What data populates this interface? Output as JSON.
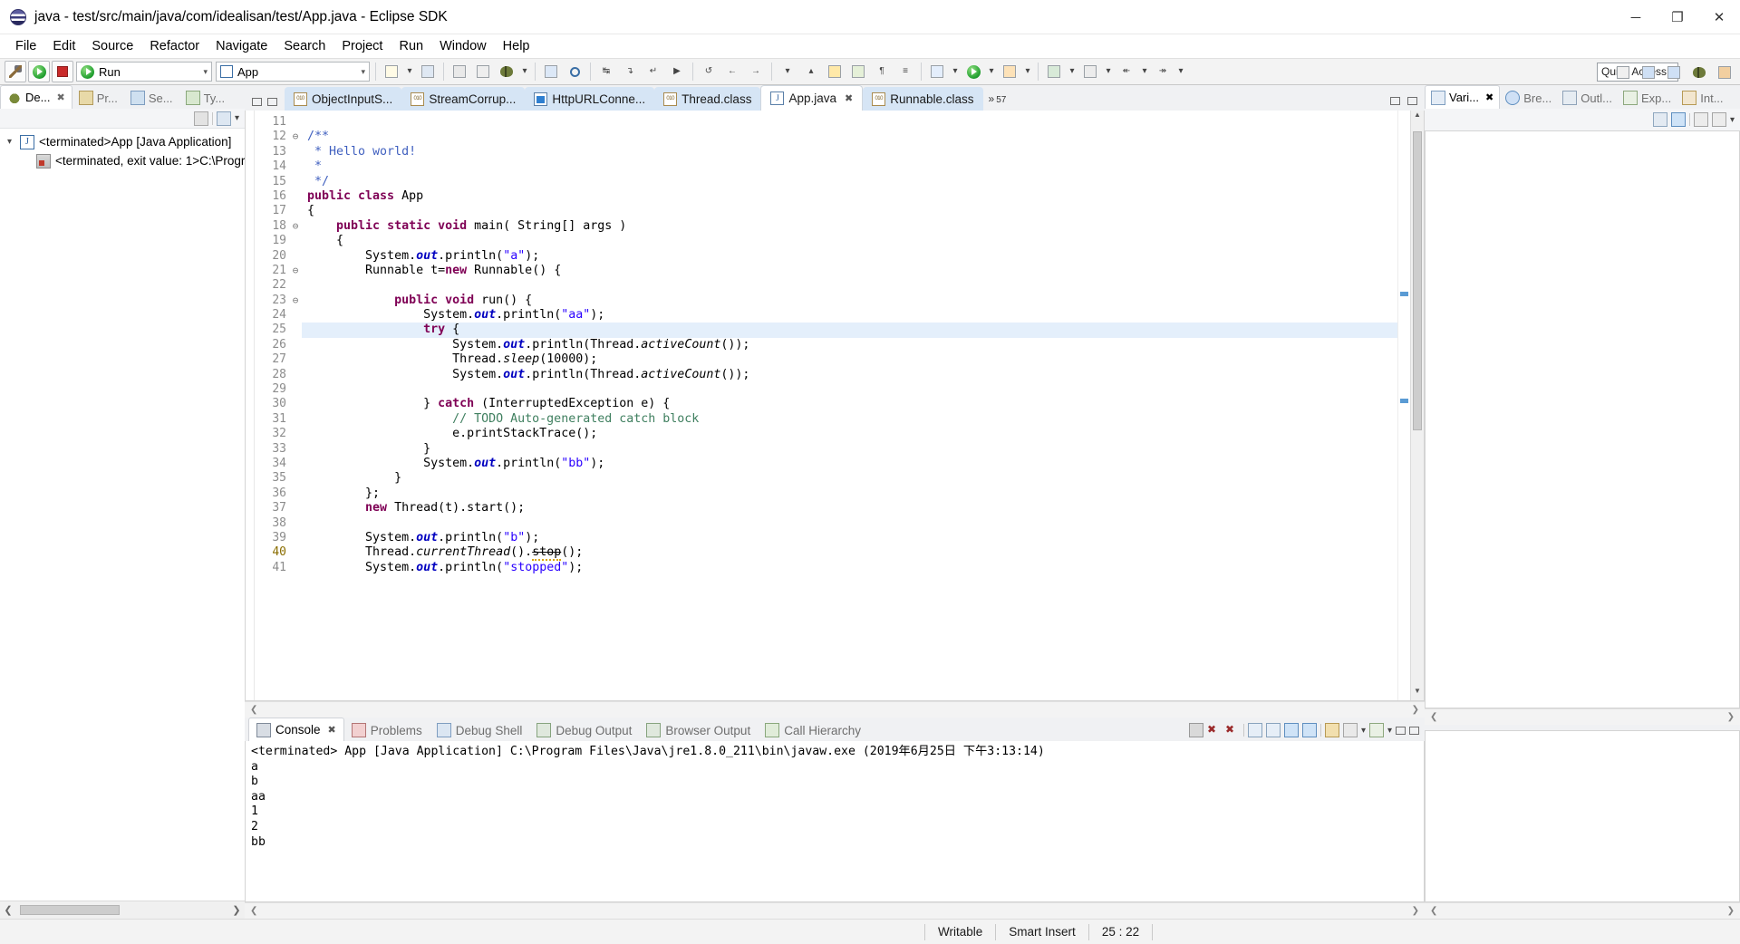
{
  "window": {
    "title": "java - test/src/main/java/com/idealisan/test/App.java - Eclipse SDK",
    "app_icon": "eclipse-icon",
    "controls": {
      "minimize": "─",
      "maximize": "❐",
      "close": "✕"
    }
  },
  "menubar": {
    "items": [
      "File",
      "Edit",
      "Source",
      "Refactor",
      "Navigate",
      "Search",
      "Project",
      "Run",
      "Window",
      "Help"
    ]
  },
  "toolbar": {
    "build_label": "hammer-icon",
    "run_combo": {
      "value": "Run",
      "icon": "run-green-icon"
    },
    "launch_combo": {
      "value": "App",
      "icon": "java-app-icon"
    },
    "quick_access": {
      "value": "Quick Access",
      "placeholder": "Quick Access"
    }
  },
  "left_panel": {
    "tabs": [
      {
        "label": "De...",
        "icon": "debug-icon",
        "active": true,
        "closable": true
      },
      {
        "label": "Pr...",
        "icon": "package-explorer-icon",
        "active": false
      },
      {
        "label": "Se...",
        "icon": "servers-icon",
        "active": false
      },
      {
        "label": "Ty...",
        "icon": "type-hierarchy-icon",
        "active": false
      }
    ],
    "tree": [
      {
        "label": "<terminated>App [Java Application]",
        "icon": "java-launch-icon",
        "indent": 0,
        "expanded": true
      },
      {
        "label": "<terminated, exit value: 1>C:\\Progr…",
        "icon": "process-icon",
        "indent": 1,
        "expanded": false
      }
    ]
  },
  "editor": {
    "tabs": [
      {
        "label": "ObjectInputS...",
        "icon": "class-file-icon",
        "active": false
      },
      {
        "label": "StreamCorrup...",
        "icon": "class-file-icon",
        "active": false
      },
      {
        "label": "HttpURLConne...",
        "icon": "html-file-icon",
        "active": false
      },
      {
        "label": "Thread.class",
        "icon": "class-file-icon",
        "active": false
      },
      {
        "label": "App.java",
        "icon": "java-file-icon",
        "active": true,
        "closable": true
      },
      {
        "label": "Runnable.class",
        "icon": "class-file-icon",
        "active": false
      }
    ],
    "overflow_label": "»",
    "overflow_count": "57",
    "first_line_number": 11,
    "highlight_line": 25,
    "lines": [
      {
        "n": 11,
        "text": ""
      },
      {
        "n": 12,
        "fold": "minus",
        "tokens": [
          {
            "t": "/**",
            "c": "jdoc"
          }
        ]
      },
      {
        "n": 13,
        "tokens": [
          {
            "t": " * Hello world!",
            "c": "jdoc"
          }
        ]
      },
      {
        "n": 14,
        "tokens": [
          {
            "t": " *",
            "c": "jdoc"
          }
        ]
      },
      {
        "n": 15,
        "tokens": [
          {
            "t": " */",
            "c": "jdoc"
          }
        ]
      },
      {
        "n": 16,
        "tokens": [
          {
            "t": "public class",
            "c": "kw"
          },
          {
            "t": " App",
            "c": ""
          }
        ]
      },
      {
        "n": 17,
        "tokens": [
          {
            "t": "{",
            "c": ""
          }
        ]
      },
      {
        "n": 18,
        "fold": "minus",
        "tokens": [
          {
            "t": "    ",
            "c": ""
          },
          {
            "t": "public static void",
            "c": "kw"
          },
          {
            "t": " main( String[] args )",
            "c": ""
          }
        ]
      },
      {
        "n": 19,
        "tokens": [
          {
            "t": "    {",
            "c": ""
          }
        ]
      },
      {
        "n": 20,
        "tokens": [
          {
            "t": "        System.",
            "c": ""
          },
          {
            "t": "out",
            "c": "fld"
          },
          {
            "t": ".println(",
            "c": ""
          },
          {
            "t": "\"a\"",
            "c": "str"
          },
          {
            "t": ");",
            "c": ""
          }
        ]
      },
      {
        "n": 21,
        "fold": "minus",
        "tokens": [
          {
            "t": "        Runnable t=",
            "c": ""
          },
          {
            "t": "new",
            "c": "kw"
          },
          {
            "t": " Runnable() {",
            "c": ""
          }
        ]
      },
      {
        "n": 22,
        "tokens": [
          {
            "t": "",
            "c": ""
          }
        ]
      },
      {
        "n": 23,
        "fold": "minus",
        "tokens": [
          {
            "t": "            ",
            "c": ""
          },
          {
            "t": "public void",
            "c": "kw"
          },
          {
            "t": " run() {",
            "c": ""
          }
        ]
      },
      {
        "n": 24,
        "tokens": [
          {
            "t": "                System.",
            "c": ""
          },
          {
            "t": "out",
            "c": "fld"
          },
          {
            "t": ".println(",
            "c": ""
          },
          {
            "t": "\"aa\"",
            "c": "str"
          },
          {
            "t": ");",
            "c": ""
          }
        ]
      },
      {
        "n": 25,
        "tokens": [
          {
            "t": "                ",
            "c": ""
          },
          {
            "t": "try",
            "c": "kw"
          },
          {
            "t": " {",
            "c": ""
          }
        ]
      },
      {
        "n": 26,
        "tokens": [
          {
            "t": "                    System.",
            "c": ""
          },
          {
            "t": "out",
            "c": "fld"
          },
          {
            "t": ".println(Thread.",
            "c": ""
          },
          {
            "t": "activeCount",
            "c": "stat"
          },
          {
            "t": "());",
            "c": ""
          }
        ]
      },
      {
        "n": 27,
        "tokens": [
          {
            "t": "                    Thread.",
            "c": ""
          },
          {
            "t": "sleep",
            "c": "stat"
          },
          {
            "t": "(10000);",
            "c": ""
          }
        ]
      },
      {
        "n": 28,
        "tokens": [
          {
            "t": "                    System.",
            "c": ""
          },
          {
            "t": "out",
            "c": "fld"
          },
          {
            "t": ".println(Thread.",
            "c": ""
          },
          {
            "t": "activeCount",
            "c": "stat"
          },
          {
            "t": "());",
            "c": ""
          }
        ]
      },
      {
        "n": 29,
        "tokens": [
          {
            "t": "",
            "c": ""
          }
        ]
      },
      {
        "n": 30,
        "tokens": [
          {
            "t": "                } ",
            "c": ""
          },
          {
            "t": "catch",
            "c": "kw"
          },
          {
            "t": " (InterruptedException e) {",
            "c": ""
          }
        ]
      },
      {
        "n": 31,
        "tokens": [
          {
            "t": "                    ",
            "c": ""
          },
          {
            "t": "// TODO Auto-generated catch block",
            "c": "cmt"
          }
        ]
      },
      {
        "n": 32,
        "tokens": [
          {
            "t": "                    e.printStackTrace();",
            "c": ""
          }
        ]
      },
      {
        "n": 33,
        "tokens": [
          {
            "t": "                }",
            "c": ""
          }
        ]
      },
      {
        "n": 34,
        "tokens": [
          {
            "t": "                System.",
            "c": ""
          },
          {
            "t": "out",
            "c": "fld"
          },
          {
            "t": ".println(",
            "c": ""
          },
          {
            "t": "\"bb\"",
            "c": "str"
          },
          {
            "t": ");",
            "c": ""
          }
        ]
      },
      {
        "n": 35,
        "tokens": [
          {
            "t": "            }",
            "c": ""
          }
        ]
      },
      {
        "n": 36,
        "tokens": [
          {
            "t": "        };",
            "c": ""
          }
        ]
      },
      {
        "n": 37,
        "tokens": [
          {
            "t": "        ",
            "c": ""
          },
          {
            "t": "new",
            "c": "kw"
          },
          {
            "t": " Thread(t).start();",
            "c": ""
          }
        ]
      },
      {
        "n": 38,
        "tokens": [
          {
            "t": "",
            "c": ""
          }
        ]
      },
      {
        "n": 39,
        "tokens": [
          {
            "t": "        System.",
            "c": ""
          },
          {
            "t": "out",
            "c": "fld"
          },
          {
            "t": ".println(",
            "c": ""
          },
          {
            "t": "\"b\"",
            "c": "str"
          },
          {
            "t": ");",
            "c": ""
          }
        ]
      },
      {
        "n": 40,
        "warn": true,
        "tokens": [
          {
            "t": "        Thread.",
            "c": ""
          },
          {
            "t": "currentThread",
            "c": "stat"
          },
          {
            "t": "().",
            "c": ""
          },
          {
            "t": "stop",
            "c": "strike squig"
          },
          {
            "t": "();",
            "c": ""
          }
        ]
      },
      {
        "n": 41,
        "tokens": [
          {
            "t": "        System.",
            "c": ""
          },
          {
            "t": "out",
            "c": "fld"
          },
          {
            "t": ".println(",
            "c": ""
          },
          {
            "t": "\"stopped\"",
            "c": "str"
          },
          {
            "t": ");",
            "c": ""
          }
        ]
      }
    ]
  },
  "console": {
    "tabs": [
      {
        "label": "Console",
        "icon": "console-icon",
        "active": true,
        "closable": true
      },
      {
        "label": "Problems",
        "icon": "problems-icon",
        "active": false
      },
      {
        "label": "Debug Shell",
        "icon": "debug-shell-icon",
        "active": false
      },
      {
        "label": "Debug Output",
        "icon": "debug-output-icon",
        "active": false
      },
      {
        "label": "Browser Output",
        "icon": "browser-output-icon",
        "active": false
      },
      {
        "label": "Call Hierarchy",
        "icon": "call-hierarchy-icon",
        "active": false
      }
    ],
    "header": "<terminated> App [Java Application] C:\\Program Files\\Java\\jre1.8.0_211\\bin\\javaw.exe (2019年6月25日 下午3:13:14)",
    "output": [
      "a",
      "b",
      "aa",
      "1",
      "2",
      "bb"
    ]
  },
  "right_panel": {
    "tabs": [
      {
        "label": "Vari...",
        "icon": "variables-icon",
        "active": true,
        "closable": true
      },
      {
        "label": "Bre...",
        "icon": "breakpoints-icon",
        "active": false
      },
      {
        "label": "Outl...",
        "icon": "outline-icon",
        "active": false
      },
      {
        "label": "Exp...",
        "icon": "expressions-icon",
        "active": false
      },
      {
        "label": "Int...",
        "icon": "interfaces-icon",
        "active": false
      }
    ]
  },
  "statusbar": {
    "writable": "Writable",
    "insert_mode": "Smart Insert",
    "cursor_position": "25 : 22"
  }
}
